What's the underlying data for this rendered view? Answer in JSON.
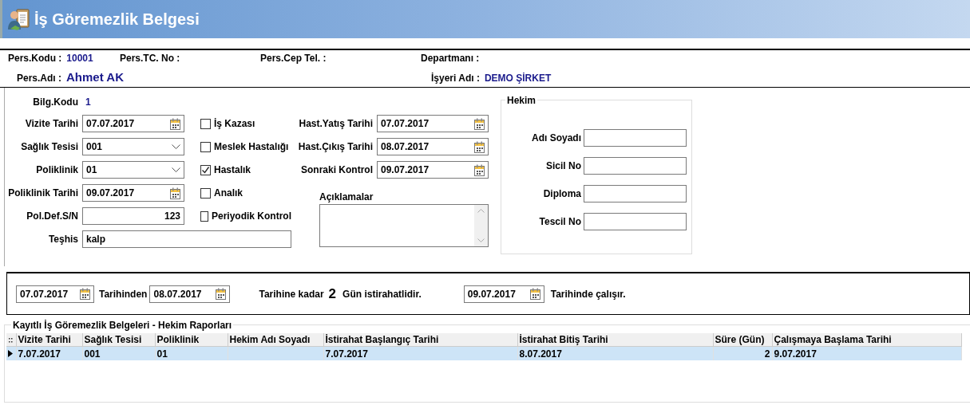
{
  "window": {
    "title": "İş Göremezlik Belgesi"
  },
  "person": {
    "code_label": "Pers.Kodu :",
    "code": "10001",
    "tc_label": "Pers.TC. No :",
    "phone_label": "Pers.Cep Tel. :",
    "department_label": "Departmanı :",
    "name_label": "Pers.Adı :",
    "name": "Ahmet  AK",
    "workplace_label": "İşyeri Adı :",
    "workplace": "DEMO ŞİRKET"
  },
  "form": {
    "code_label": "Bilg.Kodu",
    "code": "1",
    "left_fields": [
      {
        "label": "Vizite Tarihi",
        "value": "07.07.2017",
        "kind": "date"
      },
      {
        "label": "Sağlık Tesisi",
        "value": "001",
        "kind": "combo"
      },
      {
        "label": "Poliklinik",
        "value": "01",
        "kind": "combo"
      },
      {
        "label": "Poliklinik Tarihi",
        "value": "09.07.2017",
        "kind": "date"
      },
      {
        "label": "Pol.Def.S/N",
        "value": "123",
        "kind": "number"
      }
    ],
    "diagnosis": {
      "label": "Teşhis",
      "value": "kalp"
    },
    "checkboxes": [
      {
        "label": "İş Kazası",
        "checked": false
      },
      {
        "label": "Meslek Hastalığı",
        "checked": false
      },
      {
        "label": "Hastalık",
        "checked": true
      },
      {
        "label": "Analık",
        "checked": false
      },
      {
        "label": "Periyodik Kontrol",
        "checked": false
      }
    ],
    "right_fields": [
      {
        "label": "Hast.Yatış Tarihi",
        "value": "07.07.2017"
      },
      {
        "label": "Hast.Çıkış Tarihi",
        "value": "08.07.2017"
      },
      {
        "label": "Sonraki Kontrol",
        "value": "09.07.2017"
      }
    ],
    "notes_label": "Açıklamalar",
    "doctor": {
      "title": "Hekim",
      "fields": [
        {
          "label": "Adı Soyadı"
        },
        {
          "label": "Sicil No"
        },
        {
          "label": "Diploma"
        },
        {
          "label": "Tescil No"
        }
      ]
    }
  },
  "period": {
    "start": "07.07.2017",
    "start_suffix": "Tarihinden",
    "end": "08.07.2017",
    "end_suffix": "Tarihine kadar",
    "days": "2",
    "days_suffix": "Gün istirahatlidir.",
    "return_date": "09.07.2017",
    "return_suffix": "Tarihinde çalışır."
  },
  "records": {
    "title": "Kayıtlı İş Göremezlik Belgeleri - Hekim Raporları",
    "columns": [
      {
        "label": "Vizite Tarihi",
        "kind": "text"
      },
      {
        "label": "Sağlık Tesisi",
        "kind": "text"
      },
      {
        "label": "Poliklinik",
        "kind": "text"
      },
      {
        "label": "Hekim Adı Soyadı",
        "kind": "text"
      },
      {
        "label": "İstirahat Başlangıç Tarihi",
        "kind": "text"
      },
      {
        "label": "İstirahat Bitiş Tarihi",
        "kind": "text"
      },
      {
        "label": "Süre (Gün)",
        "kind": "number"
      },
      {
        "label": "Çalışmaya Başlama Tarihi",
        "kind": "text"
      }
    ],
    "rows": [
      {
        "selected": true,
        "cells": [
          "7.07.2017",
          "001",
          "01",
          "",
          "7.07.2017",
          "8.07.2017",
          "2",
          "9.07.2017"
        ]
      }
    ]
  }
}
